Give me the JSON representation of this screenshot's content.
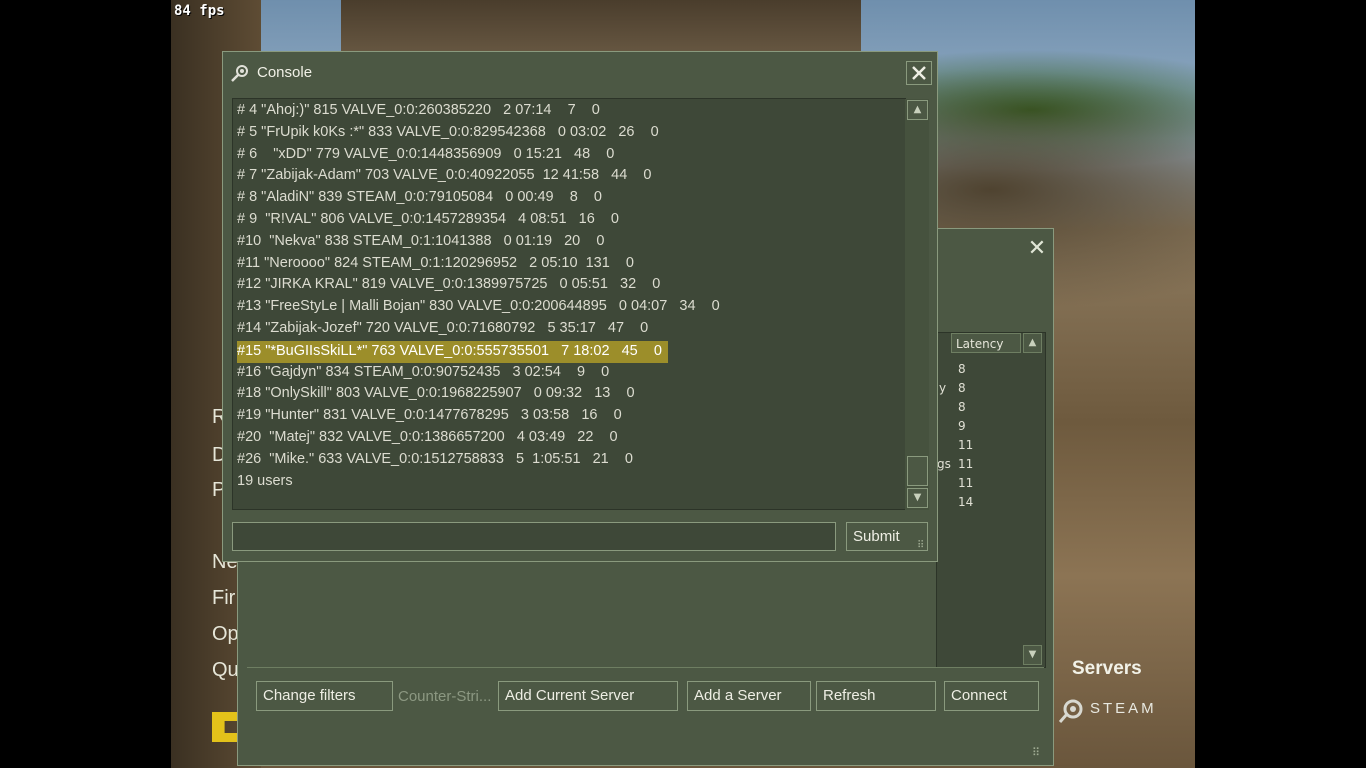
{
  "hud": {
    "fps": "84 fps"
  },
  "main_menu": {
    "items": [
      "R",
      "D",
      "P",
      "Ne",
      "Fir",
      "Op",
      "Qu"
    ]
  },
  "servers_label": "Servers",
  "steam_label": "STEAM",
  "console": {
    "title": "Console",
    "lines": [
      "# 4 \"Ahoj:)\" 815 VALVE_0:0:260385220   2 07:14    7    0",
      "# 5 \"FrUpik k0Ks :*\" 833 VALVE_0:0:829542368   0 03:02   26    0",
      "# 6    \"xDD\" 779 VALVE_0:0:1448356909   0 15:21   48    0",
      "# 7 \"Zabijak-Adam\" 703 VALVE_0:0:40922055  12 41:58   44    0",
      "# 8 \"AladiN\" 839 STEAM_0:0:79105084   0 00:49    8    0",
      "# 9  \"R!VAL\" 806 VALVE_0:0:1457289354   4 08:51   16    0",
      "#10  \"Nekva\" 838 STEAM_0:1:1041388   0 01:19   20    0",
      "#11 \"Neroooo\" 824 STEAM_0:1:120296952   2 05:10  131    0",
      "#12 \"JIRKA KRAL\" 819 VALVE_0:0:1389975725   0 05:51   32    0",
      "#13 \"FreeStyLe | Malli Bojan\" 830 VALVE_0:0:200644895   0 04:07   34    0",
      "#14 \"Zabijak-Jozef\" 720 VALVE_0:0:71680792   5 35:17   47    0",
      "#15 \"*BuGIIsSkiLL*\" 763 VALVE_0:0:555735501   7 18:02   45    0",
      "#16 \"Gajdyn\" 834 STEAM_0:0:90752435   3 02:54    9    0",
      "#18 \"OnlySkill\" 803 VALVE_0:0:1968225907   0 09:32   13    0",
      "#19 \"Hunter\" 831 VALVE_0:0:1477678295   3 03:58   16    0",
      "#20  \"Matej\" 832 VALVE_0:0:1386657200   4 03:49   22    0",
      "#26  \"Mike.\" 633 VALVE_0:0:1512758833   5  1:05:51   21    0",
      "19 users"
    ],
    "highlighted_index": 11,
    "input_value": "",
    "submit_label": "Submit"
  },
  "server_browser": {
    "column_header": "Latency",
    "latencies": [
      "8",
      "8",
      "8",
      "9",
      "11",
      "11",
      "11",
      "14"
    ],
    "partial_y": "y",
    "partial_gs": "gs",
    "buttons": {
      "change_filters": "Change filters",
      "filter_game": "Counter-Stri...",
      "add_current_server": "Add Current Server",
      "add_server": "Add a Server",
      "refresh": "Refresh",
      "connect": "Connect"
    }
  },
  "colors": {
    "panel": "#4c5844",
    "panel_dark": "#3e4838",
    "highlight": "#9c8e2a",
    "text": "#dcdcd0"
  }
}
